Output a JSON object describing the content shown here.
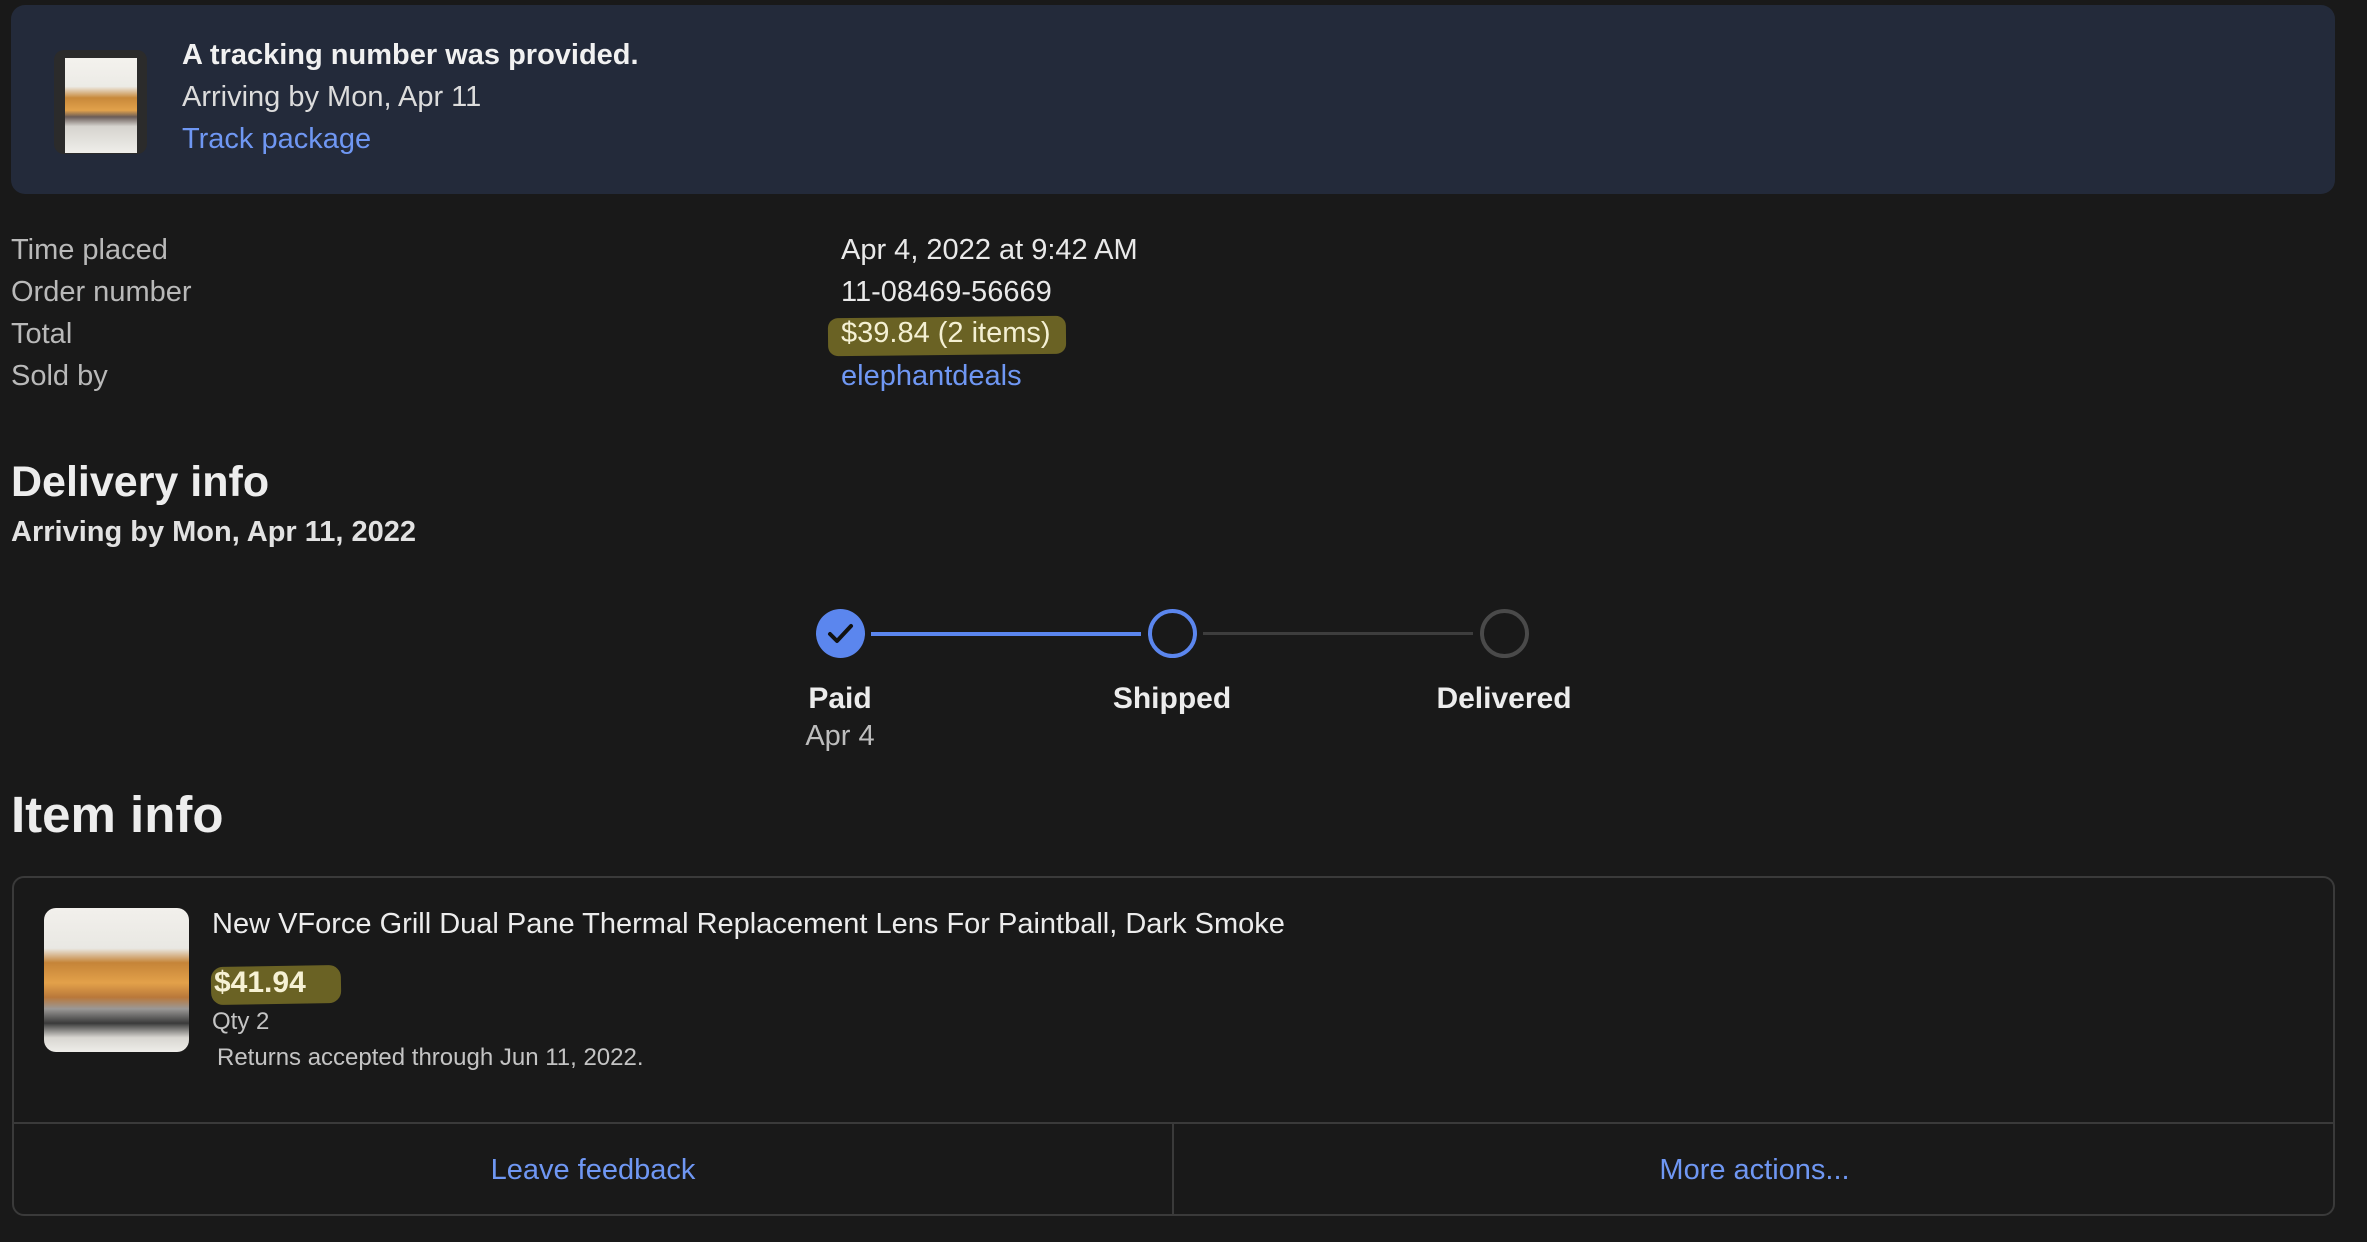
{
  "banner": {
    "title": "A tracking number was provided.",
    "arrival": "Arriving by Mon, Apr 11",
    "track_link": "Track package"
  },
  "order_details": [
    {
      "label": "Time placed",
      "value": "Apr 4, 2022 at 9:42 AM"
    },
    {
      "label": "Order number",
      "value": "11-08469-56669"
    },
    {
      "label": "Total",
      "value": "$39.84 (2 items)"
    },
    {
      "label": "Sold by",
      "value": "elephantdeals"
    }
  ],
  "delivery": {
    "title": "Delivery info",
    "subtitle": "Arriving by Mon, Apr 11, 2022",
    "steps": [
      {
        "label": "Paid",
        "date": "Apr 4",
        "status": "complete"
      },
      {
        "label": "Shipped",
        "status": "current"
      },
      {
        "label": "Delivered",
        "status": "pending"
      }
    ]
  },
  "item_info": {
    "title": "Item info",
    "item": {
      "name": "New VForce Grill Dual Pane Thermal Replacement Lens For Paintball, Dark Smoke",
      "price": "$41.94",
      "qty": "Qty 2",
      "returns": "Returns accepted through Jun 11, 2022."
    },
    "actions": {
      "feedback": "Leave feedback",
      "more": "More actions..."
    }
  },
  "colors": {
    "background": "#191919",
    "banner": "#232a3a",
    "link": "#6f97f3",
    "accent": "#5b86ee",
    "highlight": "#6a6224"
  }
}
